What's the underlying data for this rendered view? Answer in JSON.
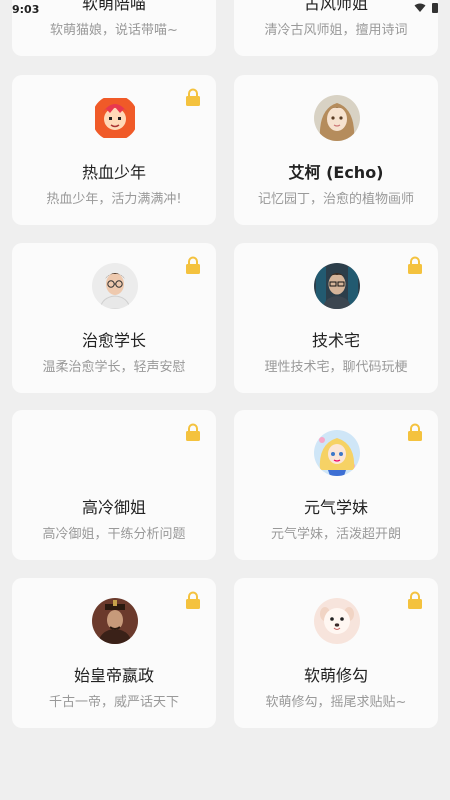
{
  "status": {
    "time": "9:03"
  },
  "top_cards": [
    {
      "name": "软萌陪喵",
      "desc": "软萌猫娘，说话带喵~"
    },
    {
      "name": "古风师姐",
      "desc": "清冷古风师姐，擅用诗词"
    }
  ],
  "cards": [
    {
      "name": "热血少年",
      "desc": "热血少年，活力满满冲!",
      "locked": true,
      "avatar_icon": "anime-boy-avatar"
    },
    {
      "name": "艾柯 (Echo)",
      "desc": "记忆园丁，治愈的植物画师",
      "locked": false,
      "avatar_icon": "anime-girl-avatar"
    },
    {
      "name": "治愈学长",
      "desc": "温柔治愈学长，轻声安慰",
      "locked": true,
      "avatar_icon": "glasses-man-avatar"
    },
    {
      "name": "技术宅",
      "desc": "理性技术宅，聊代码玩梗",
      "locked": true,
      "avatar_icon": "tech-man-avatar"
    },
    {
      "name": "高冷御姐",
      "desc": "高冷御姐，干练分析问题",
      "locked": true,
      "avatar_icon": ""
    },
    {
      "name": "元气学妹",
      "desc": "元气学妹，活泼超开朗",
      "locked": true,
      "avatar_icon": "blonde-girl-avatar"
    },
    {
      "name": "始皇帝嬴政",
      "desc": "千古一帝，威严话天下",
      "locked": true,
      "avatar_icon": "emperor-avatar"
    },
    {
      "name": "软萌修勾",
      "desc": "软萌修勾，摇尾求贴贴~",
      "locked": true,
      "avatar_icon": "puppy-avatar"
    }
  ],
  "colors": {
    "background": "#efefef",
    "card": "#fbfbfb",
    "lock": "#f4c23e"
  }
}
